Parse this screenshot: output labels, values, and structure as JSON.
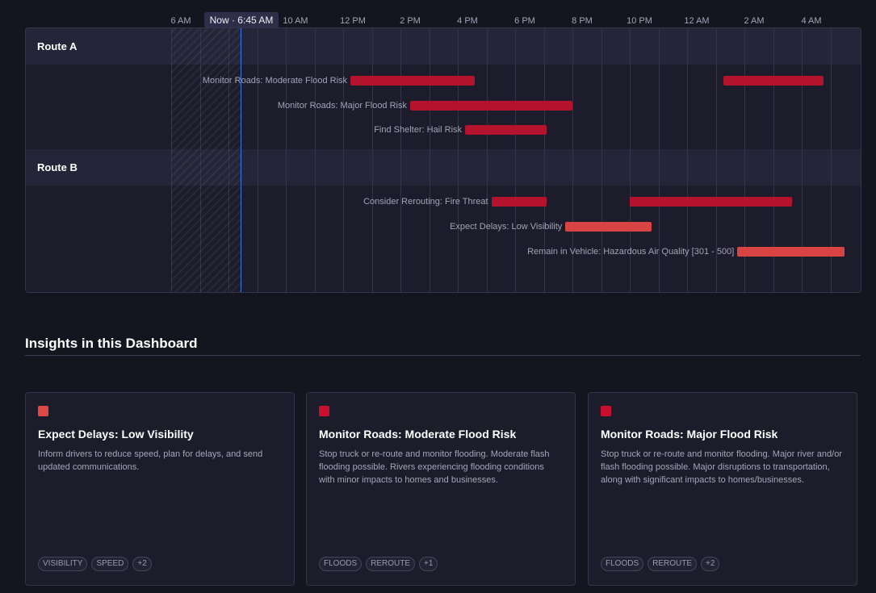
{
  "colors": {
    "background": "#151520",
    "panel": "#1c1c2a",
    "route_header": "#252539",
    "now_line": "#3a78e8",
    "flood": "#b3132d",
    "hail": "#b3132d",
    "fire": "#b3132d",
    "visibility": "#d84444",
    "air_quality": "#d84444"
  },
  "timeline": {
    "hour_labels": [
      "6 AM",
      "10 AM",
      "12 PM",
      "2 PM",
      "4 PM",
      "6 PM",
      "8 PM",
      "10 PM",
      "12 AM",
      "2 AM",
      "4 AM"
    ],
    "now_label": "Now · 6:45 AM",
    "routes": [
      {
        "name": "Route A",
        "rows": [
          {
            "label": "Monitor Roads: Moderate Flood Risk",
            "color": "#b3132d",
            "bars": [
              {
                "start": "11:55 AM",
                "end": "4:15 PM"
              },
              {
                "start": "12:55 AM",
                "end": "4:25 AM"
              }
            ]
          },
          {
            "label": "Monitor Roads: Major Flood Risk",
            "color": "#b3132d",
            "bars": [
              {
                "start": "2:00 PM",
                "end": "7:40 PM"
              }
            ]
          },
          {
            "label": "Find Shelter: Hail Risk",
            "color": "#b3132d",
            "bars": [
              {
                "start": "3:55 PM",
                "end": "6:45 PM"
              }
            ]
          }
        ]
      },
      {
        "name": "Route B",
        "rows": [
          {
            "label": "Consider Rerouting: Fire Threat",
            "color": "#b3132d",
            "bars": [
              {
                "start": "4:50 PM",
                "end": "6:45 PM"
              },
              {
                "start": "9:40 PM",
                "end": "3:20 AM"
              }
            ]
          },
          {
            "label": "Expect Delays: Low Visibility",
            "color": "#d84444",
            "bars": [
              {
                "start": "7:25 PM",
                "end": "10:25 PM"
              }
            ]
          },
          {
            "label": "Remain in Vehicle: Hazardous Air Quality [301 - 500]",
            "color": "#d84444",
            "bars": [
              {
                "start": "1:25 AM",
                "end": "5:10 AM"
              }
            ]
          }
        ]
      }
    ]
  },
  "insights": {
    "title": "Insights in this Dashboard",
    "cards": [
      {
        "swatch_color": "#e04848",
        "title": "Expect Delays: Low Visibility",
        "description": "Inform drivers to reduce speed, plan for delays, and send updated communications.",
        "tags": [
          "VISIBILITY",
          "SPEED",
          "+2"
        ]
      },
      {
        "swatch_color": "#c8102e",
        "title": "Monitor Roads: Moderate Flood Risk",
        "description": "Stop truck or re-route and monitor flooding. Moderate flash flooding possible. Rivers experiencing flooding conditions with minor impacts to homes and businesses.",
        "tags": [
          "FLOODS",
          "REROUTE",
          "+1"
        ]
      },
      {
        "swatch_color": "#c8102e",
        "title": "Monitor Roads: Major Flood Risk",
        "description": "Stop truck or re-route and monitor flooding. Major river and/or flash flooding possible. Major disruptions to transportation, along with significant impacts to homes/businesses.",
        "tags": [
          "FLOODS",
          "REROUTE",
          "+2"
        ]
      }
    ]
  }
}
